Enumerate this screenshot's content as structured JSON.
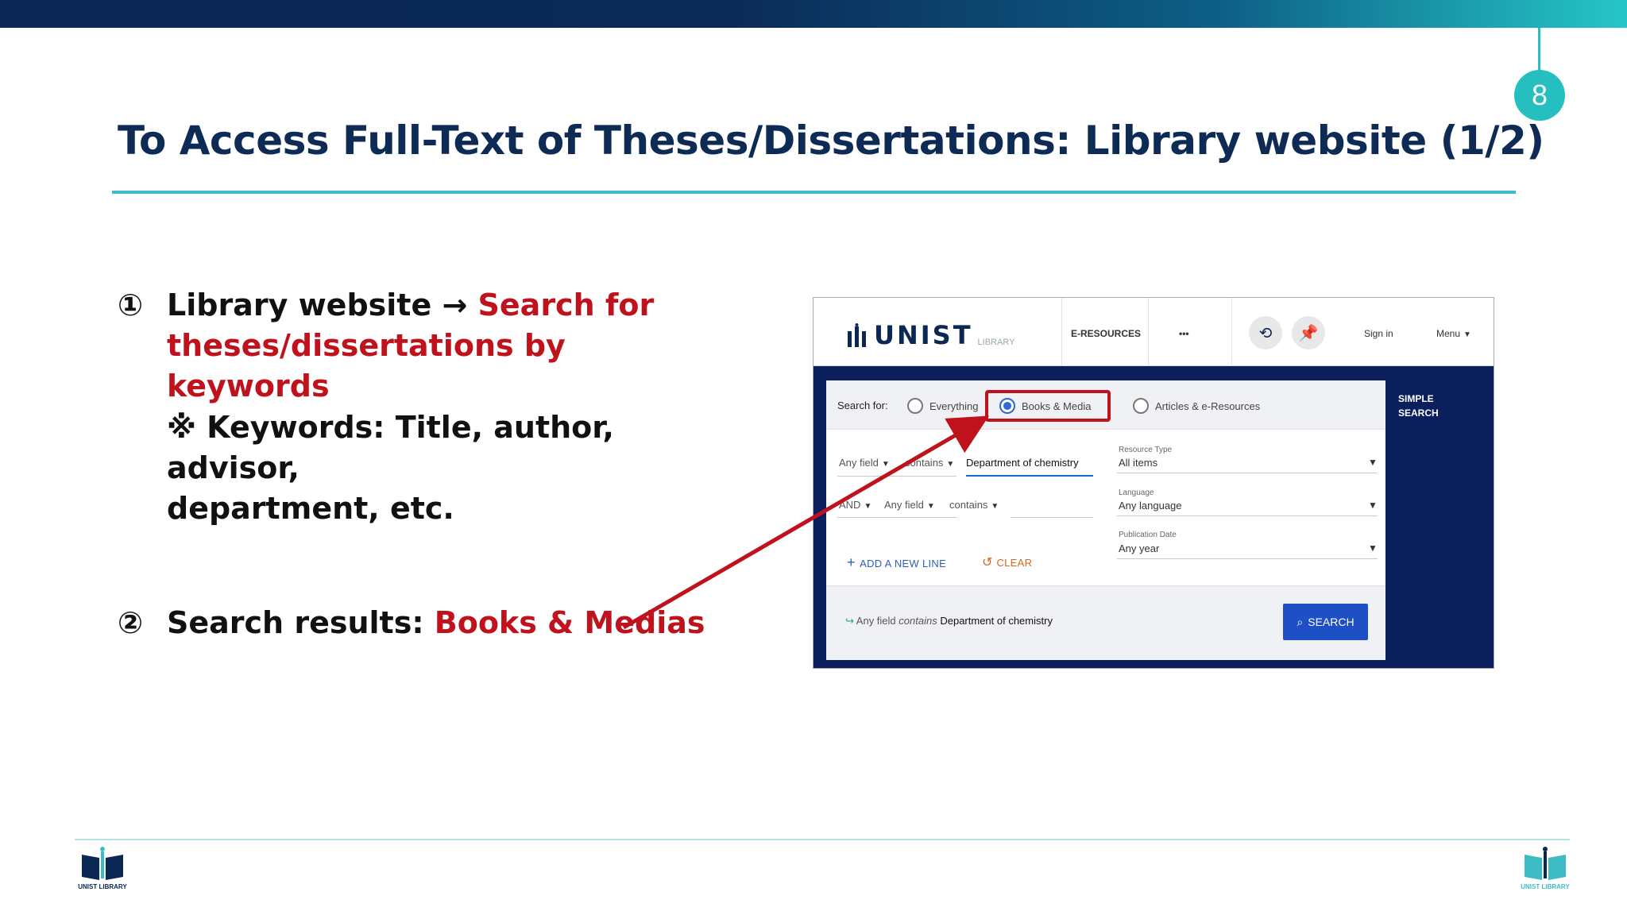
{
  "slide": {
    "page_number": "8",
    "title": "To Access Full-Text of Theses/Dissertations: Library website (1/2)"
  },
  "points": {
    "p1_num": "①",
    "p1_text": "Library website → ",
    "p1_red_a": "Search for",
    "p1_red_b": "theses/dissertations by keywords",
    "p1_note_a": "※ Keywords: Title, author, advisor,",
    "p1_note_b": "department, etc.",
    "p2_num": "②",
    "p2_text": "Search results: ",
    "p2_red": "Books & Medias"
  },
  "logos": {
    "left_text": "UNIST LIBRARY",
    "right_text": "UNIST LIBRARY"
  },
  "library_site": {
    "brand": "UNIST",
    "brand_sub": "LIBRARY",
    "nav": {
      "eresources": "E-RESOURCES",
      "more": "•••",
      "sign_in": "Sign in",
      "menu": "Menu"
    },
    "search_for_label": "Search for:",
    "scope_options": [
      "Everything",
      "Books & Media",
      "Articles & e-Resources"
    ],
    "row1": {
      "field": "Any field",
      "operator": "contains",
      "value": "Department of chemistry"
    },
    "row2": {
      "bool": "AND",
      "field": "Any field",
      "operator": "contains",
      "value": ""
    },
    "filters": {
      "resource_type_label": "Resource Type",
      "resource_type_value": "All items",
      "language_label": "Language",
      "language_value": "Any language",
      "pub_date_label": "Publication Date",
      "pub_date_value": "Any year"
    },
    "add_line": "ADD A NEW LINE",
    "clear": "CLEAR",
    "query_summary": {
      "field": "Any field",
      "op": "contains",
      "value": "Department of chemistry"
    },
    "search_button": "SEARCH",
    "simple_search_a": "SIMPLE",
    "simple_search_b": "SEARCH"
  },
  "colors": {
    "title": "#0d2b55",
    "accent": "#3dbdc3",
    "highlight_red": "#c0121c",
    "search_blue": "#1f4fc4"
  }
}
